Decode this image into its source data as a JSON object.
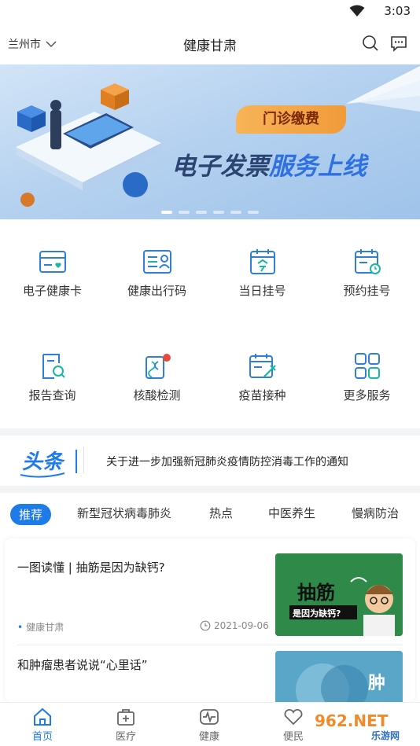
{
  "status": {
    "time": "3:03"
  },
  "header": {
    "city": "兰州市",
    "title": "健康甘肃"
  },
  "banner": {
    "subtitle": "门诊缴费",
    "headline_dark": "电子发票",
    "headline_blue": "服务上线",
    "dots": 6,
    "active_dot": 0
  },
  "services": [
    {
      "label": "电子健康卡",
      "icon": "health-card-icon"
    },
    {
      "label": "健康出行码",
      "icon": "travel-code-icon"
    },
    {
      "label": "当日挂号",
      "icon": "today-register-icon"
    },
    {
      "label": "预约挂号",
      "icon": "appointment-icon"
    },
    {
      "label": "报告查询",
      "icon": "report-search-icon"
    },
    {
      "label": "核酸检测",
      "icon": "nucleic-test-icon"
    },
    {
      "label": "疫苗接种",
      "icon": "vaccine-icon"
    },
    {
      "label": "更多服务",
      "icon": "more-services-icon"
    }
  ],
  "news": {
    "logo": "头条",
    "headline": "关于进一步加强新冠肺炎疫情防控消毒工作的通知"
  },
  "tabs": [
    {
      "label": "推荐",
      "active": true
    },
    {
      "label": "新型冠状病毒肺炎",
      "active": false
    },
    {
      "label": "热点",
      "active": false
    },
    {
      "label": "中医养生",
      "active": false
    },
    {
      "label": "慢病防治",
      "active": false
    }
  ],
  "articles": [
    {
      "title": "一图读懂 | 抽筋是因为缺钙?",
      "source": "健康甘肃",
      "date": "2021-09-06",
      "thumb_title": "抽筋",
      "thumb_sub": "是因为缺钙?"
    },
    {
      "title": "和肿瘤患者说说“心里话”",
      "thumb_text": "肿"
    }
  ],
  "bottom_nav": [
    {
      "label": "首页",
      "icon": "home-icon",
      "active": true
    },
    {
      "label": "医疗",
      "icon": "medical-icon",
      "active": false
    },
    {
      "label": "健康",
      "icon": "health-icon",
      "active": false
    },
    {
      "label": "便民",
      "icon": "convenience-icon",
      "active": false
    }
  ],
  "watermark": {
    "brand": "962.NET",
    "sub": "乐游网"
  },
  "colors": {
    "accent": "#1e7be8",
    "icon_blue": "#2f7fd8",
    "banner_orange": "#f19b3a"
  }
}
